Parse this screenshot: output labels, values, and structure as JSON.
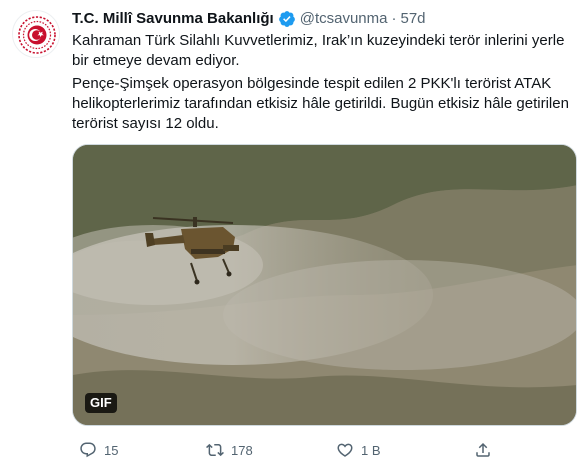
{
  "account": {
    "name": "T.C. Millî Savunma Bakanlığı",
    "handle": "@tcsavunma",
    "separator": "·",
    "time": "57d",
    "avatar_icon": "ministry-emblem-icon",
    "verified_icon": "verified-badge-icon"
  },
  "tweet": {
    "paragraphs": [
      "Kahraman Türk Silahlı Kuvvetlerimiz, Irak’ın kuzeyindeki terör inlerini yerle bir etmeye devam ediyor.",
      "Pençe-Şimşek operasyon bölgesinde tespit edilen 2 PKK'lı terörist ATAK helikopterlerimiz tarafından etkisiz hâle getirildi. Bugün etkisiz hâle getirilen terörist sayısı 12 oldu."
    ]
  },
  "media": {
    "badge": "GIF"
  },
  "actions": {
    "reply": {
      "icon": "reply-icon",
      "count": "15"
    },
    "retweet": {
      "icon": "retweet-icon",
      "count": "178"
    },
    "like": {
      "icon": "like-icon",
      "count": "1 B"
    },
    "share": {
      "icon": "share-icon"
    }
  },
  "colors": {
    "text": "#0f1419",
    "secondary": "#536471",
    "verified": "#1d9bf0",
    "emblem": "#c8102e"
  }
}
